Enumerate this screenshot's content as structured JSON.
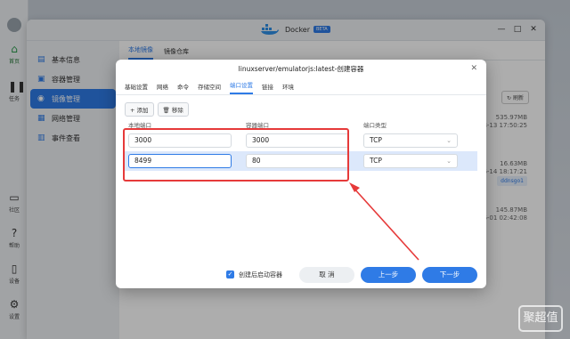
{
  "desktop": {
    "dock_items": [
      {
        "label": "首页",
        "icon": "home-icon"
      },
      {
        "label": "任务",
        "icon": "tasks-icon"
      },
      {
        "label": "社区",
        "icon": "community-icon"
      },
      {
        "label": "帮助",
        "icon": "help-icon"
      },
      {
        "label": "设备",
        "icon": "device-icon"
      },
      {
        "label": "设置",
        "icon": "settings-icon"
      }
    ]
  },
  "window": {
    "app_name": "Docker",
    "badge": "BETA",
    "nav": [
      "基本信息",
      "容器管理",
      "镜像管理",
      "网络管理",
      "事件查看"
    ],
    "subtabs": [
      "本地镜像",
      "镜像仓库"
    ],
    "refresh_label": "刷新",
    "bg_rows": [
      {
        "size": "535.97MB",
        "date": "2-08-13 17:50:25"
      },
      {
        "size": "16.63MB",
        "date": "2-06-14 18:17:21",
        "tag": "ddnsgo1"
      },
      {
        "size": "145.87MB",
        "date": "2-06-01 02:42:08"
      }
    ]
  },
  "dialog": {
    "title": "linuxserver/emulatorjs:latest-创建容器",
    "tabs": [
      "基础设置",
      "网络",
      "命令",
      "存储空间",
      "端口设置",
      "链接",
      "环境"
    ],
    "active_tab": "端口设置",
    "add_label": "添加",
    "remove_label": "移除",
    "col_local": "本地端口",
    "col_container": "容器端口",
    "col_type": "端口类型",
    "rows": [
      {
        "local": "3000",
        "container": "3000",
        "type": "TCP"
      },
      {
        "local": "8499",
        "container": "80",
        "type": "TCP"
      }
    ],
    "autostart_label": "创建后启动容器",
    "cancel_label": "取 消",
    "prev_label": "上一步",
    "next_label": "下一步"
  },
  "watermark": "聚超值"
}
